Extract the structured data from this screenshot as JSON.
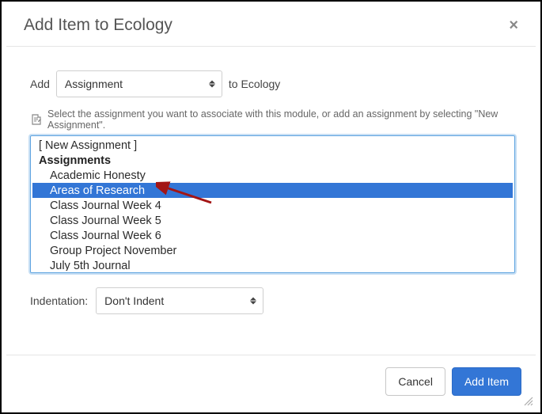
{
  "dialog": {
    "title": "Add Item to Ecology"
  },
  "addRow": {
    "prefix": "Add",
    "typeSelected": "Assignment",
    "suffix": "to Ecology"
  },
  "instructions": "Select the assignment you want to associate with this module, or add an assignment by selecting \"New Assignment\".",
  "listbox": {
    "newItem": "[ New Assignment ]",
    "groupLabel": "Assignments",
    "items": [
      "Academic Honesty",
      "Areas of Research",
      "Class Journal Week 4",
      "Class Journal Week 5",
      "Class Journal Week 6",
      "Group Project November",
      "July 5th Journal"
    ],
    "selectedIndex": 1
  },
  "indentation": {
    "label": "Indentation:",
    "selected": "Don't Indent"
  },
  "footer": {
    "cancel": "Cancel",
    "addItem": "Add Item"
  }
}
